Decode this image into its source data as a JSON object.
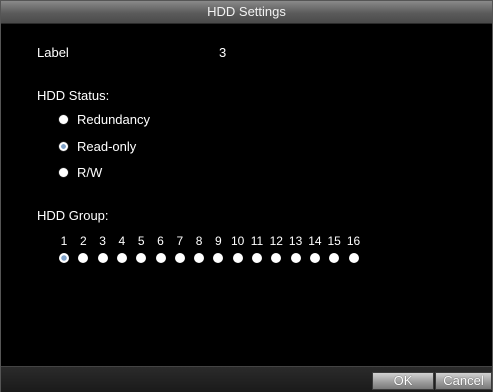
{
  "window": {
    "title": "HDD Settings"
  },
  "label": {
    "caption": "Label",
    "value": "3"
  },
  "hdd_status": {
    "caption": "HDD Status:",
    "options": [
      {
        "label": "Redundancy",
        "selected": false
      },
      {
        "label": "Read-only",
        "selected": true
      },
      {
        "label": "R/W",
        "selected": false
      }
    ]
  },
  "hdd_group": {
    "caption": "HDD Group:",
    "numbers": [
      "1",
      "2",
      "3",
      "4",
      "5",
      "6",
      "7",
      "8",
      "9",
      "10",
      "11",
      "12",
      "13",
      "14",
      "15",
      "16"
    ],
    "selected": "1"
  },
  "buttons": {
    "ok": "OK",
    "cancel": "Cancel"
  }
}
